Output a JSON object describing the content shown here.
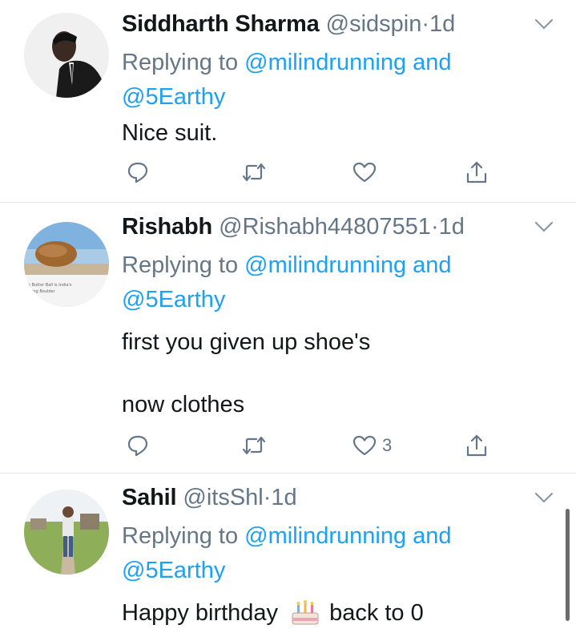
{
  "tweets": [
    {
      "name": "Siddharth Sharma",
      "handle": "@sidspin",
      "separator": "·",
      "time": "1d",
      "replying_prefix": "Replying to ",
      "mention1": "@milindrunning",
      "and": " and",
      "mention2": "@5Earthy",
      "text_lines": [
        "Nice suit."
      ],
      "like_count": "",
      "avatar": "person-in-suit-photo"
    },
    {
      "name": "Rishabh",
      "handle": "@Rishabh44807551",
      "separator": "·",
      "time": "1d",
      "replying_prefix": "Replying to ",
      "mention1": "@milindrunning",
      "and": " and",
      "mention2": "@5Earthy",
      "text_lines": [
        "first you given up shoe's",
        "now clothes"
      ],
      "like_count": "3",
      "avatar": "balancing-boulder-photo",
      "avatar_caption": "'s Butter Ball is India's ... ing Boulder"
    },
    {
      "name": "Sahil",
      "handle": "@itsShl",
      "separator": "·",
      "time": "1d",
      "replying_prefix": "Replying to ",
      "mention1": "@milindrunning",
      "and": " and",
      "mention2": "@5Earthy",
      "text_lines": [
        "Happy birthday",
        "back to 0"
      ],
      "emoji": "birthday-cake",
      "like_count": "",
      "avatar": "man-standing-outdoors-photo"
    }
  ],
  "icons": {
    "reply": "reply-icon",
    "retweet": "retweet-icon",
    "like": "heart-icon",
    "share": "share-icon",
    "more": "chevron-down-icon"
  },
  "colors": {
    "text": "#14171a",
    "secondary": "#657786",
    "link": "#1da1f2",
    "divider": "#e1e8ed"
  }
}
